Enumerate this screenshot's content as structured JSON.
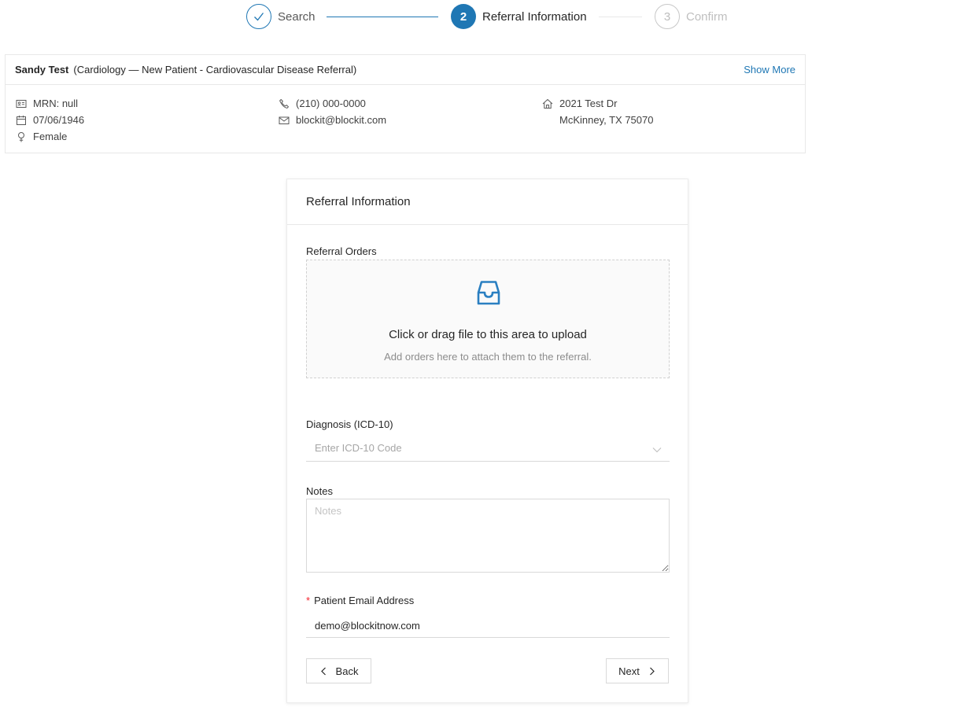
{
  "steps": [
    {
      "number": "1",
      "title": "Search",
      "status": "finished"
    },
    {
      "number": "2",
      "title": "Referral Information",
      "status": "active"
    },
    {
      "number": "3",
      "title": "Confirm",
      "status": "waiting"
    }
  ],
  "patient": {
    "name": "Sandy Test",
    "referral_desc": "(Cardiology — New Patient - Cardiovascular Disease Referral)",
    "show_more": "Show More",
    "mrn": "MRN: null",
    "dob": "07/06/1946",
    "gender": "Female",
    "phone": "(210) 000-0000",
    "email": "blockit@blockit.com",
    "address_line1": "2021 Test Dr",
    "address_line2": "McKinney, TX 75070"
  },
  "form": {
    "title": "Referral Information",
    "referral_orders_label": "Referral Orders",
    "upload_text": "Click or drag file to this area to upload",
    "upload_hint": "Add orders here to attach them to the referral.",
    "diagnosis_label": "Diagnosis (ICD-10)",
    "diagnosis_placeholder": "Enter ICD-10 Code",
    "notes_label": "Notes",
    "notes_placeholder": "Notes",
    "email_required_mark": "*",
    "email_label": "Patient Email Address",
    "email_value": "demo@blockitnow.com",
    "back_label": "Back",
    "next_label": "Next"
  },
  "colors": {
    "primary": "#1f77b4",
    "required": "#f5222d",
    "upload_icon": "#2a7fc1"
  },
  "icons": {
    "step1": "check-icon",
    "mrn": "id-card-icon",
    "dob": "calendar-icon",
    "gender": "female-icon",
    "phone": "phone-icon",
    "email": "mail-icon",
    "address": "home-icon",
    "upload": "inbox-icon",
    "select": "chevron-down-icon",
    "back": "chevron-left-icon",
    "next": "chevron-right-icon"
  }
}
